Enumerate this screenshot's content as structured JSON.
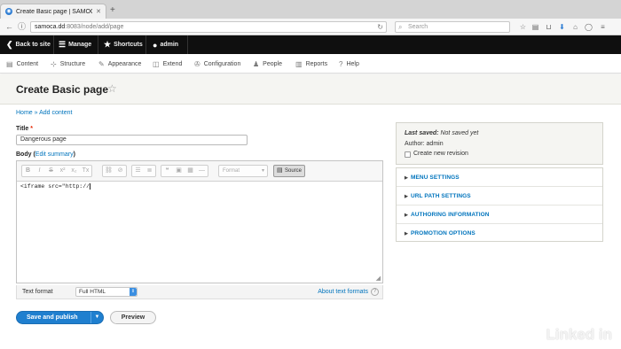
{
  "browser": {
    "tab_title": "Create Basic page | SAMOCA",
    "new_tab": "+",
    "url_host": "samoca.dd",
    "url_path": ":8083/node/add/page",
    "search_placeholder": "Search"
  },
  "toolbar": {
    "back_label": "Back to site",
    "manage_label": "Manage",
    "shortcuts_label": "Shortcuts",
    "user_label": "admin"
  },
  "admin_menu": [
    {
      "label": "Content",
      "icon": "content-icon"
    },
    {
      "label": "Structure",
      "icon": "structure-icon"
    },
    {
      "label": "Appearance",
      "icon": "appearance-icon"
    },
    {
      "label": "Extend",
      "icon": "extend-icon"
    },
    {
      "label": "Configuration",
      "icon": "configuration-icon"
    },
    {
      "label": "People",
      "icon": "people-icon"
    },
    {
      "label": "Reports",
      "icon": "reports-icon"
    },
    {
      "label": "Help",
      "icon": "help-icon"
    }
  ],
  "page": {
    "title": "Create Basic page",
    "breadcrumb_home": "Home",
    "breadcrumb_sep": "»",
    "breadcrumb_current": "Add content"
  },
  "form": {
    "title_label": "Title",
    "required_mark": "*",
    "title_value": "Dangerous page",
    "body_label": "Body",
    "edit_summary": "Edit summary",
    "format_placeholder": "Format",
    "source_label": "Source",
    "body_source": "<iframe src=\"http://",
    "text_format_label": "Text format",
    "text_format_value": "Full HTML",
    "about_formats": "About text formats",
    "save_label": "Save and publish",
    "preview_label": "Preview"
  },
  "sidebar": {
    "last_saved_label": "Last saved:",
    "last_saved_value": "Not saved yet",
    "author_label": "Author:",
    "author_value": "admin",
    "new_revision_label": "Create new revision",
    "sections": [
      "MENU SETTINGS",
      "URL PATH SETTINGS",
      "AUTHORING INFORMATION",
      "PROMOTION OPTIONS"
    ]
  },
  "watermark": "Linked in",
  "colors": {
    "accent": "#0074bd",
    "primary_button": "#1f7fcf",
    "toolbar": "#0f0f0f"
  }
}
